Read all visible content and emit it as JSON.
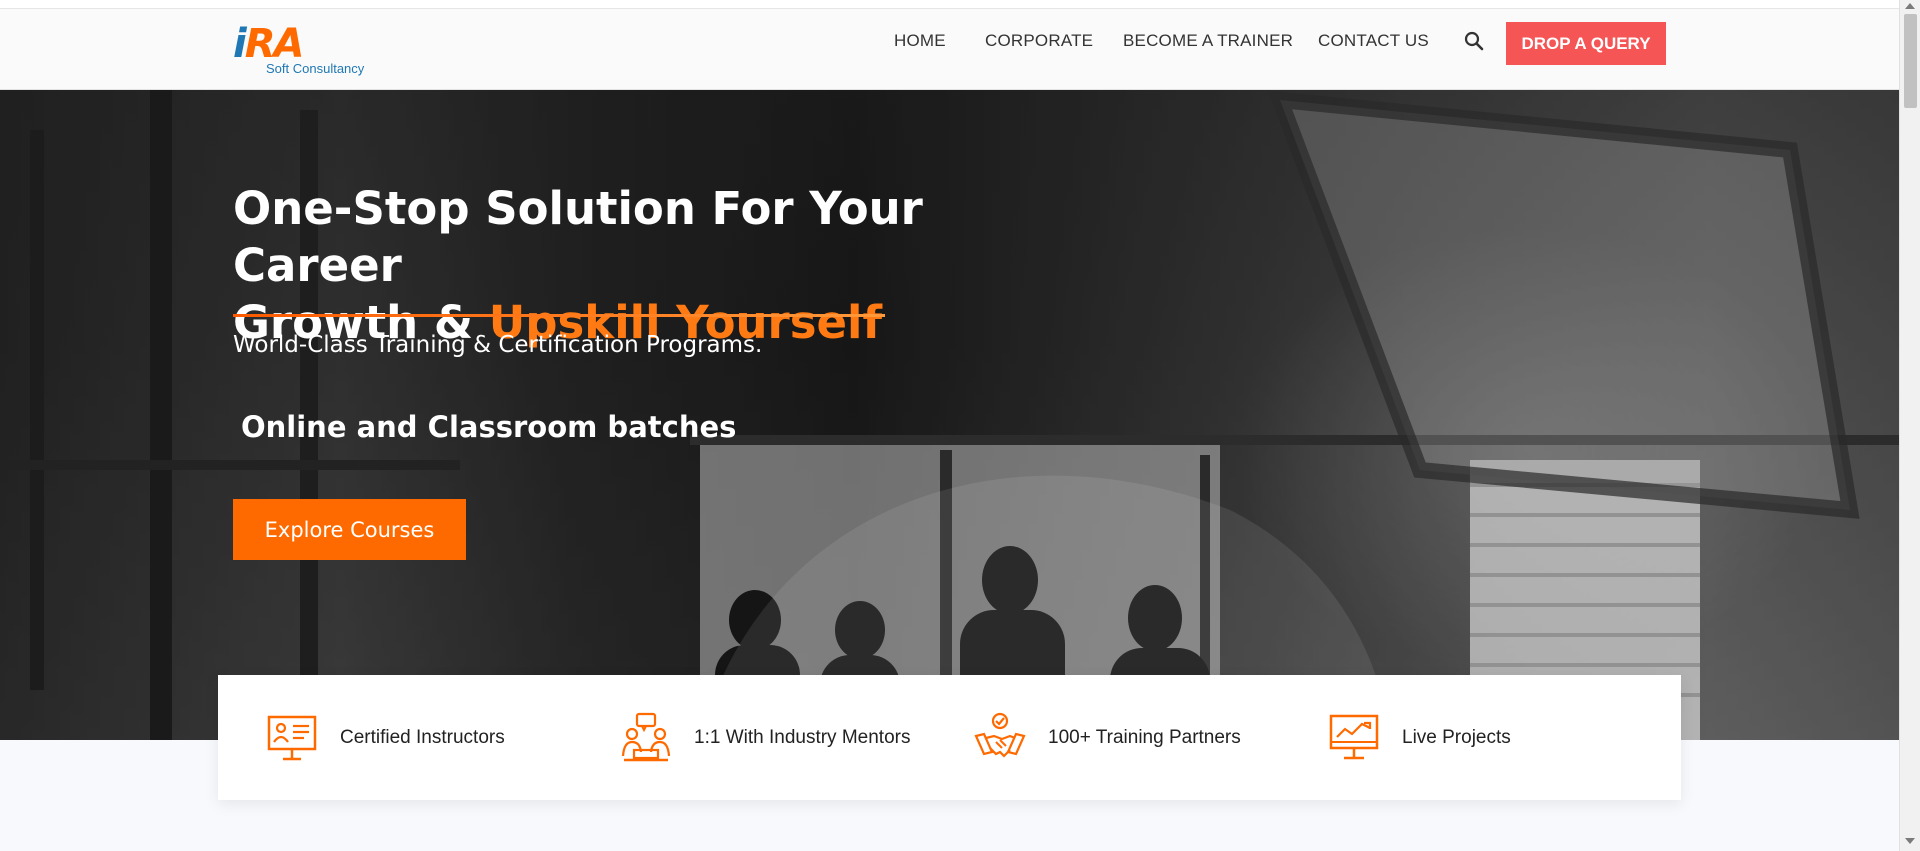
{
  "header": {
    "logo_mark_i": "i",
    "logo_mark_ra": "RA",
    "logo_subtitle": "Soft Consultancy",
    "nav": [
      {
        "label": "HOME"
      },
      {
        "label": "CORPORATE"
      },
      {
        "label": "BECOME A TRAINER"
      },
      {
        "label": "CONTACT US"
      }
    ],
    "search_icon": "search-icon",
    "query_button": "DROP A QUERY"
  },
  "hero": {
    "title_line1": "One-Stop Solution For Your Career",
    "title_line2_plain": "Growth & ",
    "title_line2_highlight": "Upskill Yourself",
    "subtitle": "World-Class Training & Certification Programs.",
    "batches": "Online and Classroom batches",
    "cta": "Explore Courses"
  },
  "features": [
    {
      "label": "Certified Instructors",
      "icon": "instructor-presentation-icon"
    },
    {
      "label": "1:1 With Industry Mentors",
      "icon": "mentor-meeting-icon"
    },
    {
      "label": "100+ Training Partners",
      "icon": "handshake-icon"
    },
    {
      "label": "Live Projects",
      "icon": "analytics-monitor-icon"
    }
  ],
  "colors": {
    "accent": "#ff6a00",
    "query_button": "#f55555",
    "logo_blue": "#1f78b4"
  }
}
